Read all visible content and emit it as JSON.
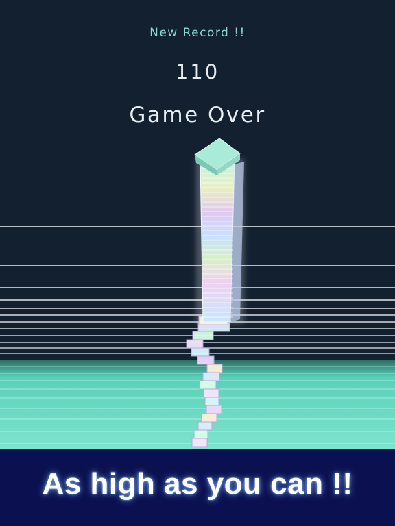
{
  "hud": {
    "record_label": "New Record !!",
    "score": "110",
    "status": "Game Over"
  },
  "banner": {
    "slogan": "As high as you can !!"
  },
  "colors": {
    "sky": "#132030",
    "floor": "#6fe0c8",
    "tower_top": "#a8ecd8",
    "banner_bg": "#0b1150"
  },
  "tower": {
    "block_count": 110
  }
}
